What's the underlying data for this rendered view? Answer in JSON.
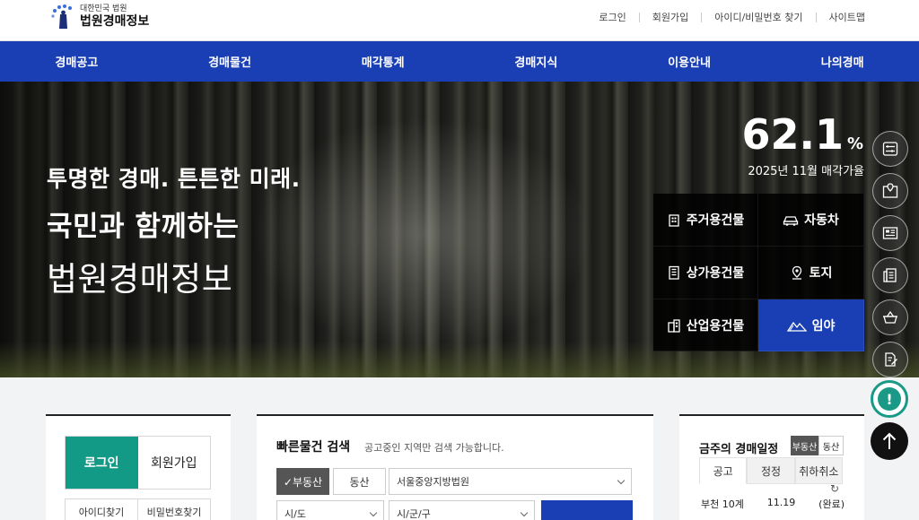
{
  "header": {
    "logo_sub": "대한민국 법원",
    "logo_main": "법원경매정보",
    "util_links": [
      "로그인",
      "회원가입",
      "아이디/비밀번호 찾기",
      "사이트맵"
    ]
  },
  "nav": {
    "items": [
      "경매공고",
      "경매물건",
      "매각통계",
      "경매지식",
      "이용안내",
      "나의경매"
    ]
  },
  "hero": {
    "line1": "투명한 경매. 튼튼한 미래.",
    "line2": "국민과 함께하는",
    "line3": "법원경매정보",
    "rate_value": "62.1",
    "rate_unit": "%",
    "rate_label": "2025년 11월 매각가율",
    "categories": [
      {
        "label": "주거용건물",
        "icon": "building-icon"
      },
      {
        "label": "자동차",
        "icon": "car-icon"
      },
      {
        "label": "상가용건물",
        "icon": "store-building-icon"
      },
      {
        "label": "토지",
        "icon": "location-pin-icon"
      },
      {
        "label": "산업용건물",
        "icon": "factory-icon"
      },
      {
        "label": "임야",
        "icon": "mountain-icon"
      }
    ]
  },
  "quick_bar": {
    "icons": [
      "sliders-icon",
      "map-pin-icon",
      "newspaper-icon",
      "document-list-icon",
      "basket-icon",
      "document-edit-icon"
    ]
  },
  "login_panel": {
    "tab_login": "로그인",
    "tab_join": "회원가입",
    "link_find_id": "아이디찾기",
    "link_find_pw": "비밀번호찾기"
  },
  "search_panel": {
    "title": "빠른물건 검색",
    "note": "공고중인 지역만 검색 가능합니다.",
    "tab_real_estate": "✓부동산",
    "tab_movable": "동산",
    "court_select": "서울중앙지방법원",
    "sido_select": "시/도",
    "sigungu_select": "시/군/구"
  },
  "schedule_panel": {
    "title": "금주의 경매일정",
    "toggle_real_estate": "부동산",
    "toggle_movable": "동산",
    "tabs": [
      "공고",
      "정정",
      "취하취소"
    ],
    "row_place": "부천 10계",
    "row_date": "11.19",
    "row_status": "(완료)"
  },
  "colors": {
    "primary": "#1a3fb5",
    "teal": "#139a86",
    "dark": "#111111"
  }
}
